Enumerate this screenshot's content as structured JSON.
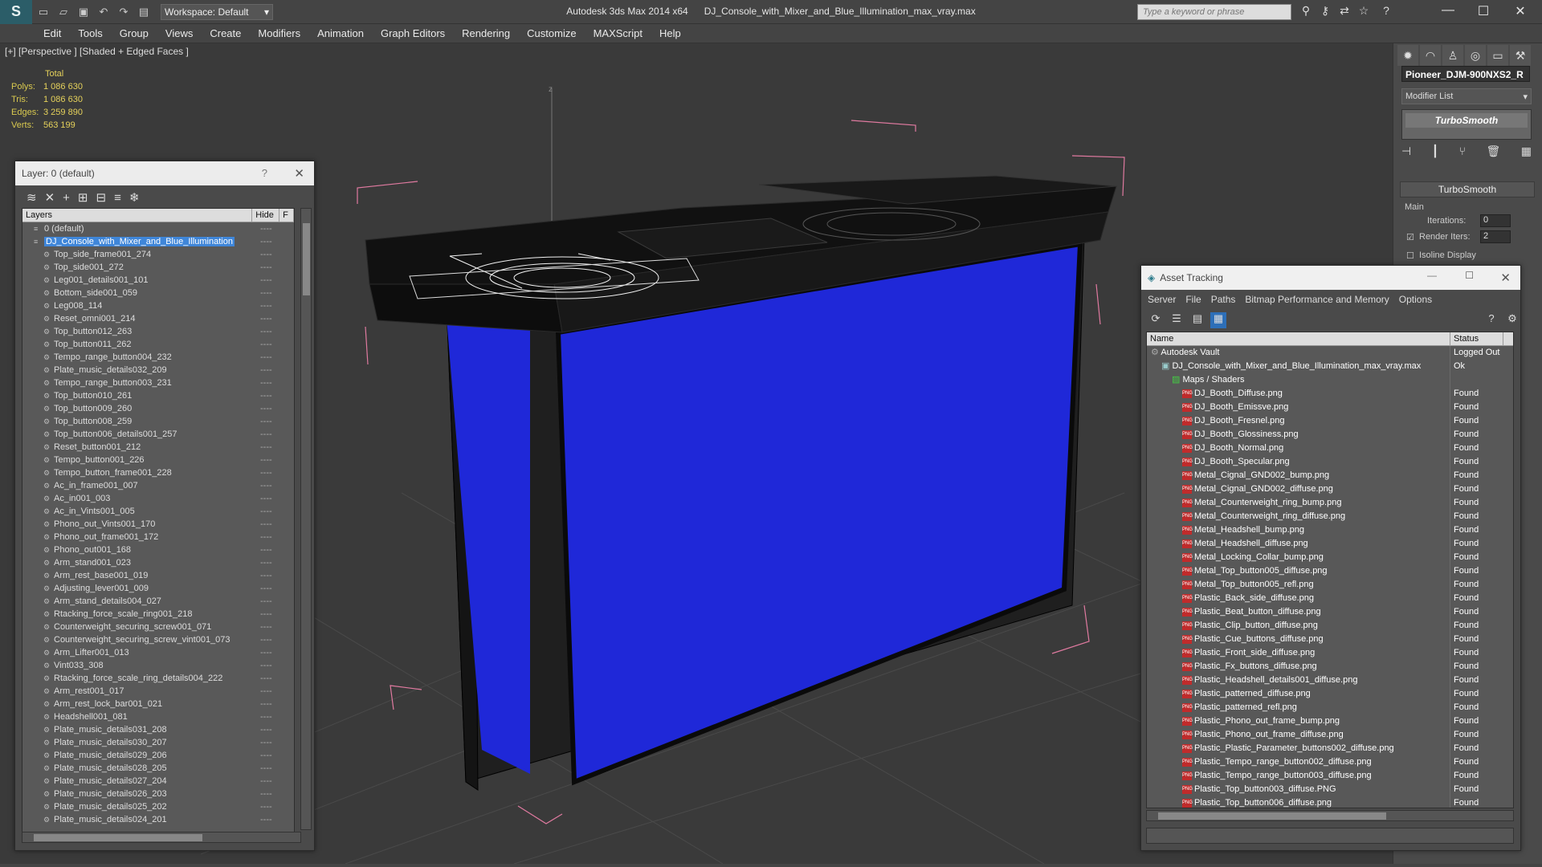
{
  "titlebar": {
    "app": "Autodesk 3ds Max  2014 x64",
    "file": "DJ_Console_with_Mixer_and_Blue_Illumination_max_vray.max",
    "workspace": "Workspace: Default",
    "search_placeholder": "Type a keyword or phrase"
  },
  "menu": [
    "Edit",
    "Tools",
    "Group",
    "Views",
    "Create",
    "Modifiers",
    "Animation",
    "Graph Editors",
    "Rendering",
    "Customize",
    "MAXScript",
    "Help"
  ],
  "viewport": {
    "label": "[+] [Perspective ] [Shaded + Edged Faces ]",
    "stats_header": "Total",
    "stats": [
      {
        "k": "Polys:",
        "v": "1 086 630"
      },
      {
        "k": "Tris:",
        "v": "1 086 630"
      },
      {
        "k": "Edges:",
        "v": "3 259 890"
      },
      {
        "k": "Verts:",
        "v": "563 199"
      }
    ],
    "axis_label": "z",
    "panel_color": "#1f28d8"
  },
  "command_panel": {
    "object_name": "Pioneer_DJM-900NXS2_R",
    "modifier_list": "Modifier List",
    "modifier": "TurboSmooth",
    "rollout": "TurboSmooth",
    "group": "Main",
    "iterations_label": "Iterations:",
    "iterations": "0",
    "render_iters_label": "Render Iters:",
    "render_iters": "2",
    "isoline_label": "Isoline Display"
  },
  "layer_window": {
    "title": "Layer: 0 (default)",
    "help": "?",
    "col_layers": "Layers",
    "col_hide": "Hide",
    "col_f": "F",
    "rows": [
      {
        "name": "0 (default)",
        "level": 1
      },
      {
        "name": "DJ_Console_with_Mixer_and_Blue_Illumination",
        "level": 1,
        "selected": true
      },
      {
        "name": "Top_side_frame001_274",
        "level": 2
      },
      {
        "name": "Top_side001_272",
        "level": 2
      },
      {
        "name": "Leg001_details001_101",
        "level": 2
      },
      {
        "name": "Bottom_side001_059",
        "level": 2
      },
      {
        "name": "Leg008_114",
        "level": 2
      },
      {
        "name": "Reset_omni001_214",
        "level": 2
      },
      {
        "name": "Top_button012_263",
        "level": 2
      },
      {
        "name": "Top_button011_262",
        "level": 2
      },
      {
        "name": "Tempo_range_button004_232",
        "level": 2
      },
      {
        "name": "Plate_music_details032_209",
        "level": 2
      },
      {
        "name": "Tempo_range_button003_231",
        "level": 2
      },
      {
        "name": "Top_button010_261",
        "level": 2
      },
      {
        "name": "Top_button009_260",
        "level": 2
      },
      {
        "name": "Top_button008_259",
        "level": 2
      },
      {
        "name": "Top_button006_details001_257",
        "level": 2
      },
      {
        "name": "Reset_button001_212",
        "level": 2
      },
      {
        "name": "Tempo_button001_226",
        "level": 2
      },
      {
        "name": "Tempo_button_frame001_228",
        "level": 2
      },
      {
        "name": "Ac_in_frame001_007",
        "level": 2
      },
      {
        "name": "Ac_in001_003",
        "level": 2
      },
      {
        "name": "Ac_in_Vints001_005",
        "level": 2
      },
      {
        "name": "Phono_out_Vints001_170",
        "level": 2
      },
      {
        "name": "Phono_out_frame001_172",
        "level": 2
      },
      {
        "name": "Phono_out001_168",
        "level": 2
      },
      {
        "name": "Arm_stand001_023",
        "level": 2
      },
      {
        "name": "Arm_rest_base001_019",
        "level": 2
      },
      {
        "name": "Adjusting_lever001_009",
        "level": 2
      },
      {
        "name": "Arm_stand_details004_027",
        "level": 2
      },
      {
        "name": "Rtacking_force_scale_ring001_218",
        "level": 2
      },
      {
        "name": "Counterweight_securing_screw001_071",
        "level": 2
      },
      {
        "name": "Counterweight_securing_screw_vint001_073",
        "level": 2
      },
      {
        "name": "Arm_Lifter001_013",
        "level": 2
      },
      {
        "name": "Vint033_308",
        "level": 2
      },
      {
        "name": "Rtacking_force_scale_ring_details004_222",
        "level": 2
      },
      {
        "name": "Arm_rest001_017",
        "level": 2
      },
      {
        "name": "Arm_rest_lock_bar001_021",
        "level": 2
      },
      {
        "name": "Headshell001_081",
        "level": 2
      },
      {
        "name": "Plate_music_details031_208",
        "level": 2
      },
      {
        "name": "Plate_music_details030_207",
        "level": 2
      },
      {
        "name": "Plate_music_details029_206",
        "level": 2
      },
      {
        "name": "Plate_music_details028_205",
        "level": 2
      },
      {
        "name": "Plate_music_details027_204",
        "level": 2
      },
      {
        "name": "Plate_music_details026_203",
        "level": 2
      },
      {
        "name": "Plate_music_details025_202",
        "level": 2
      },
      {
        "name": "Plate_music_details024_201",
        "level": 2
      }
    ]
  },
  "asset_window": {
    "title": "Asset Tracking",
    "menu": [
      "Server",
      "File",
      "Paths",
      "Bitmap Performance and Memory",
      "Options"
    ],
    "col_name": "Name",
    "col_status": "Status",
    "rows": [
      {
        "name": "Autodesk Vault",
        "status": "Logged Out",
        "indent": 1,
        "icon": "vault"
      },
      {
        "name": "DJ_Console_with_Mixer_and_Blue_Illumination_max_vray.max",
        "status": "Ok",
        "indent": 2,
        "icon": "max"
      },
      {
        "name": "Maps / Shaders",
        "status": "",
        "indent": 3,
        "icon": "maps"
      },
      {
        "name": "DJ_Booth_Diffuse.png",
        "status": "Found",
        "indent": 4,
        "icon": "png"
      },
      {
        "name": "DJ_Booth_Emissve.png",
        "status": "Found",
        "indent": 4,
        "icon": "png"
      },
      {
        "name": "DJ_Booth_Fresnel.png",
        "status": "Found",
        "indent": 4,
        "icon": "png"
      },
      {
        "name": "DJ_Booth_Glossiness.png",
        "status": "Found",
        "indent": 4,
        "icon": "png"
      },
      {
        "name": "DJ_Booth_Normal.png",
        "status": "Found",
        "indent": 4,
        "icon": "png"
      },
      {
        "name": "DJ_Booth_Specular.png",
        "status": "Found",
        "indent": 4,
        "icon": "png"
      },
      {
        "name": "Metal_Cignal_GND002_bump.png",
        "status": "Found",
        "indent": 4,
        "icon": "png"
      },
      {
        "name": "Metal_Cignal_GND002_diffuse.png",
        "status": "Found",
        "indent": 4,
        "icon": "png"
      },
      {
        "name": "Metal_Counterweight_ring_bump.png",
        "status": "Found",
        "indent": 4,
        "icon": "png"
      },
      {
        "name": "Metal_Counterweight_ring_diffuse.png",
        "status": "Found",
        "indent": 4,
        "icon": "png"
      },
      {
        "name": "Metal_Headshell_bump.png",
        "status": "Found",
        "indent": 4,
        "icon": "png"
      },
      {
        "name": "Metal_Headshell_diffuse.png",
        "status": "Found",
        "indent": 4,
        "icon": "png"
      },
      {
        "name": "Metal_Locking_Collar_bump.png",
        "status": "Found",
        "indent": 4,
        "icon": "png"
      },
      {
        "name": "Metal_Top_button005_diffuse.png",
        "status": "Found",
        "indent": 4,
        "icon": "png"
      },
      {
        "name": "Metal_Top_button005_refl.png",
        "status": "Found",
        "indent": 4,
        "icon": "png"
      },
      {
        "name": "Plastic_Back_side_diffuse.png",
        "status": "Found",
        "indent": 4,
        "icon": "png"
      },
      {
        "name": "Plastic_Beat_button_diffuse.png",
        "status": "Found",
        "indent": 4,
        "icon": "png"
      },
      {
        "name": "Plastic_Clip_button_diffuse.png",
        "status": "Found",
        "indent": 4,
        "icon": "png"
      },
      {
        "name": "Plastic_Cue_buttons_diffuse.png",
        "status": "Found",
        "indent": 4,
        "icon": "png"
      },
      {
        "name": "Plastic_Front_side_diffuse.png",
        "status": "Found",
        "indent": 4,
        "icon": "png"
      },
      {
        "name": "Plastic_Fx_buttons_diffuse.png",
        "status": "Found",
        "indent": 4,
        "icon": "png"
      },
      {
        "name": "Plastic_Headshell_details001_diffuse.png",
        "status": "Found",
        "indent": 4,
        "icon": "png"
      },
      {
        "name": "Plastic_patterned_diffuse.png",
        "status": "Found",
        "indent": 4,
        "icon": "png"
      },
      {
        "name": "Plastic_patterned_refl.png",
        "status": "Found",
        "indent": 4,
        "icon": "png"
      },
      {
        "name": "Plastic_Phono_out_frame_bump.png",
        "status": "Found",
        "indent": 4,
        "icon": "png"
      },
      {
        "name": "Plastic_Phono_out_frame_diffuse.png",
        "status": "Found",
        "indent": 4,
        "icon": "png"
      },
      {
        "name": "Plastic_Plastic_Parameter_buttons002_diffuse.png",
        "status": "Found",
        "indent": 4,
        "icon": "png"
      },
      {
        "name": "Plastic_Tempo_range_button002_diffuse.png",
        "status": "Found",
        "indent": 4,
        "icon": "png"
      },
      {
        "name": "Plastic_Tempo_range_button003_diffuse.png",
        "status": "Found",
        "indent": 4,
        "icon": "png"
      },
      {
        "name": "Plastic_Top_button003_diffuse.PNG",
        "status": "Found",
        "indent": 4,
        "icon": "png"
      },
      {
        "name": "Plastic_Top_button006_diffuse.png",
        "status": "Found",
        "indent": 4,
        "icon": "png"
      }
    ]
  }
}
